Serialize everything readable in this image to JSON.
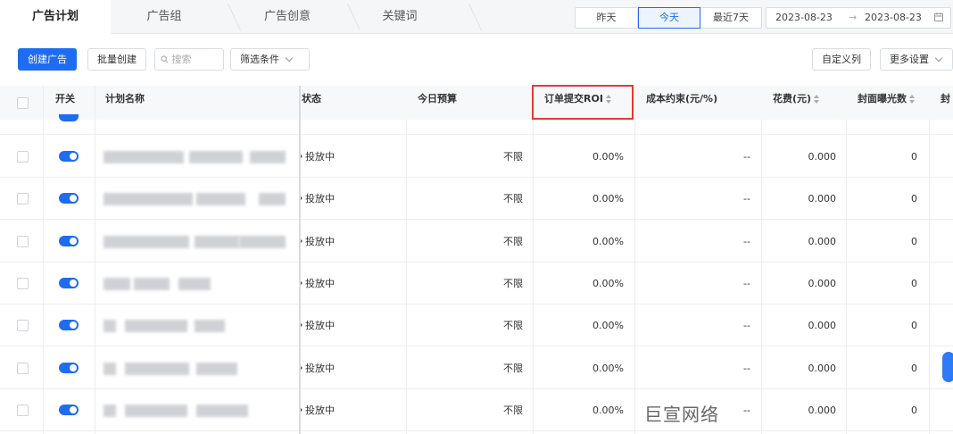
{
  "tabs": [
    {
      "label": "广告计划",
      "active": true
    },
    {
      "label": "广告组",
      "active": false
    },
    {
      "label": "广告创意",
      "active": false
    },
    {
      "label": "关键词",
      "active": false
    }
  ],
  "date_filters": [
    {
      "label": "昨天",
      "active": false
    },
    {
      "label": "今天",
      "active": true
    },
    {
      "label": "最近7天",
      "active": false
    }
  ],
  "date_range": {
    "start": "2023-08-23",
    "separator": "→",
    "end": "2023-08-23"
  },
  "toolbar": {
    "create_label": "创建广告",
    "batch_create_label": "批量创建",
    "search_placeholder": "搜索",
    "filter_label": "筛选条件",
    "custom_columns_label": "自定义列",
    "more_settings_label": "更多设置"
  },
  "columns": {
    "switch": "开关",
    "plan_name": "计划名称",
    "status": "状态",
    "budget": "今日预算",
    "order_roi": "订单提交ROI",
    "cost_constraint": "成本约束(元/%)",
    "spend": "花费(元)",
    "cover_impressions": "封面曝光数",
    "cover_partial": "封"
  },
  "rows": [
    {
      "status": "投放中",
      "budget": "不限",
      "roi": "0.00%",
      "cost": "--",
      "spend": "0.000",
      "impressions": "0"
    },
    {
      "status": "投放中",
      "budget": "不限",
      "roi": "0.00%",
      "cost": "--",
      "spend": "0.000",
      "impressions": "0"
    },
    {
      "status": "投放中",
      "budget": "不限",
      "roi": "0.00%",
      "cost": "--",
      "spend": "0.000",
      "impressions": "0"
    },
    {
      "status": "投放中",
      "budget": "不限",
      "roi": "0.00%",
      "cost": "--",
      "spend": "0.000",
      "impressions": "0"
    },
    {
      "status": "投放中",
      "budget": "不限",
      "roi": "0.00%",
      "cost": "--",
      "spend": "0.000",
      "impressions": "0"
    },
    {
      "status": "投放中",
      "budget": "不限",
      "roi": "0.00%",
      "cost": "--",
      "spend": "0.000",
      "impressions": "0"
    },
    {
      "status": "投放中",
      "budget": "不限",
      "roi": "0.00%",
      "cost": "--",
      "spend": "0.000",
      "impressions": "0"
    }
  ],
  "watermark": "巨宣网络",
  "colors": {
    "accent": "#1e6cf2",
    "highlight": "#e53935"
  },
  "icons": {
    "search": "search-icon",
    "calendar": "calendar-icon",
    "sort": "sort-icon",
    "chevron": "chevron-down-icon"
  }
}
